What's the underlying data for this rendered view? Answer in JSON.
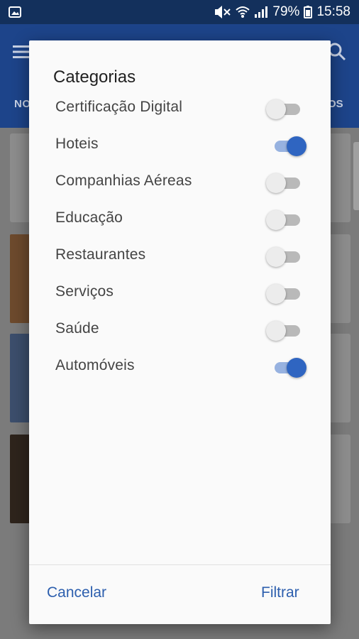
{
  "status_bar": {
    "battery": "79%",
    "time": "15:58",
    "icons": [
      "image-icon",
      "mute-icon",
      "wifi-icon",
      "signal-icon",
      "battery-icon"
    ]
  },
  "app_bar": {
    "tab_left_partial": "NO",
    "tab_right_partial": "OS",
    "icons": [
      "menu-icon",
      "search-icon"
    ]
  },
  "dialog": {
    "title": "Categorias",
    "categories": [
      {
        "label": "Certificação Digital",
        "enabled": false
      },
      {
        "label": "Hoteis",
        "enabled": true
      },
      {
        "label": "Companhias Aéreas",
        "enabled": false
      },
      {
        "label": "Educação",
        "enabled": false
      },
      {
        "label": "Restaurantes",
        "enabled": false
      },
      {
        "label": "Serviços",
        "enabled": false
      },
      {
        "label": "Saúde",
        "enabled": false
      },
      {
        "label": "Automóveis",
        "enabled": true
      }
    ],
    "cancel_label": "Cancelar",
    "filter_label": "Filtrar"
  },
  "colors": {
    "accent": "#2f65c1",
    "button_text": "#2d5fae",
    "status_bar": "#13305c",
    "app_bar": "#1d448a"
  }
}
